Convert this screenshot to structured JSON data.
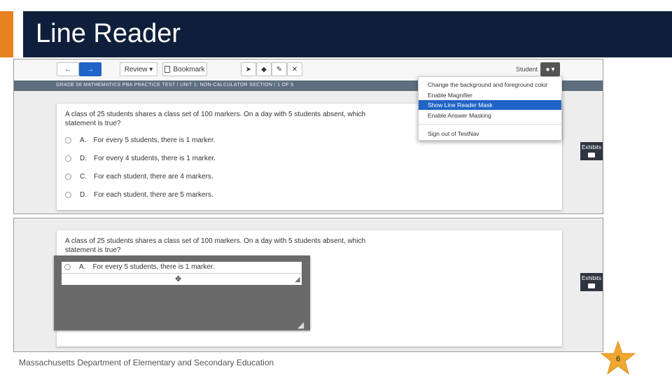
{
  "slide": {
    "title": "Line Reader",
    "footer": "Massachusetts Department of Elementary and Secondary Education",
    "page_number": "6",
    "accent_color": "#e8811f",
    "title_bar_color": "#0f1f3b"
  },
  "toolbar": {
    "back_icon": "arrow-left-icon",
    "back_label": "←",
    "next_icon": "arrow-right-icon",
    "next_label": "→",
    "review_label": "Review ▾",
    "bookmark_label": "Bookmark",
    "student_label": "Student",
    "user_icon": "user-icon",
    "user_label": "▾",
    "tools": [
      "pointer-icon",
      "eraser-icon",
      "highlighter-icon",
      "strikethrough-icon"
    ],
    "next_color": "#1f64c6"
  },
  "breadcrumb": "GRADE 06 MATHEMATICS PBA PRACTICE TEST  /  UNIT 1: NON-CALCULATOR SECTION  /  1 OF 5",
  "menu": {
    "items": [
      "Change the background and foreground color",
      "Enable Magnifier",
      "Show Line Reader Mask",
      "Enable Answer Masking",
      "Sign out of TestNav"
    ],
    "selected": "Show Line Reader Mask"
  },
  "question": {
    "text": "A class of 25 students shares a class set of 100 markers. On a day with 5 students absent, which statement is true?",
    "options": [
      {
        "letter": "A.",
        "text": "For every 5 students, there is 1 marker."
      },
      {
        "letter": "D.",
        "text": "For every 4 students, there is 1 marker."
      },
      {
        "letter": "C.",
        "text": "For each student, there are 4 markers."
      },
      {
        "letter": "D.",
        "text": "For each student, there are 5 markers."
      }
    ]
  },
  "exhibits": {
    "label": "Exhibits",
    "icon": "folder-icon"
  },
  "line_reader": {
    "visible_option_letter": "A.",
    "visible_option_text": "For every 5 students, there is 1 marker.",
    "move_icon": "move-icon",
    "move_glyph": "✥",
    "resize_glyph": "◢"
  }
}
